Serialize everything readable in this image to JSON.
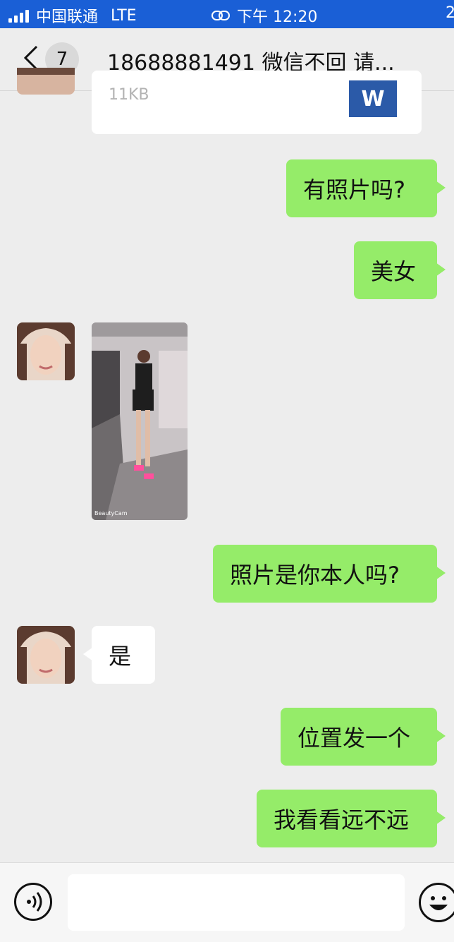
{
  "status": {
    "carrier": "中国联通",
    "network": "LTE",
    "time": "下午 12:20",
    "right_text": "2"
  },
  "header": {
    "unread_count": "7",
    "title": "18688881491 微信不回 请..."
  },
  "file": {
    "size": "11KB",
    "icon_letter": "W"
  },
  "messages": {
    "m1": "有照片吗?",
    "m2": "美女",
    "m3": "照片是你本人吗?",
    "m4": "是",
    "m5": "位置发一个",
    "m6": "我看看远不远"
  },
  "photo_watermark": "BeautyCam",
  "colors": {
    "outgoing": "#95ec69",
    "incoming": "#ffffff",
    "statusbar": "#1a5fd6"
  }
}
